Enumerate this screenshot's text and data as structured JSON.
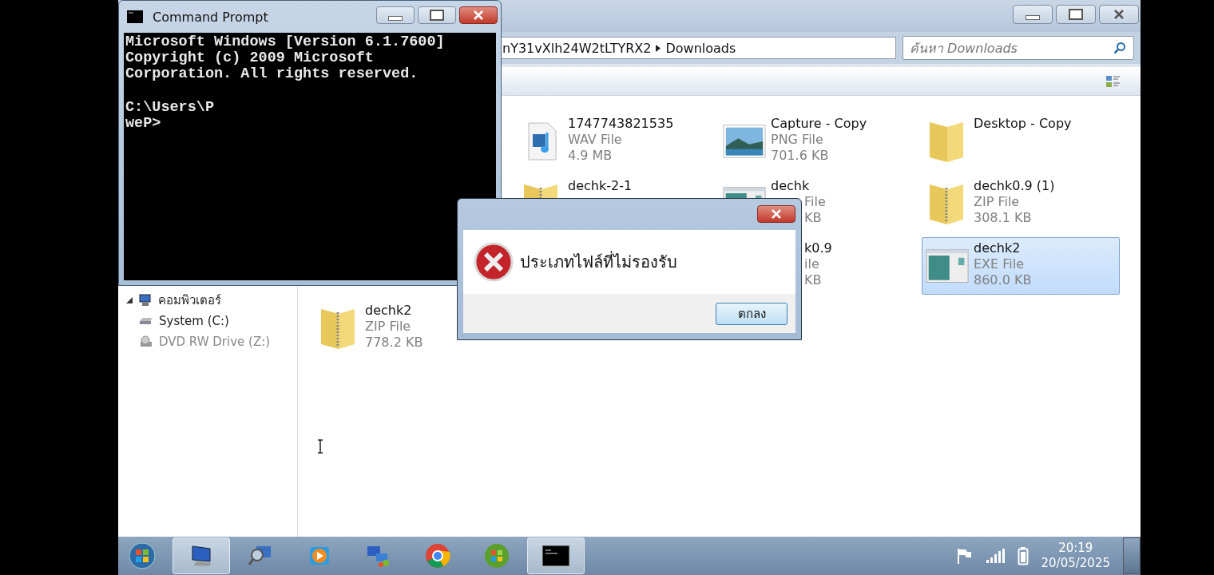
{
  "explorer": {
    "address": [
      "nY31vXlh24W2tLTYRX2",
      "Downloads"
    ],
    "search": {
      "placeholder": "ค้นหา Downloads"
    },
    "sidebar": [
      {
        "label": "คอมพิวเตอร์",
        "kind": "group",
        "expanded": true,
        "disabled": false
      },
      {
        "label": "System (C:)",
        "kind": "drive",
        "disabled": false
      },
      {
        "label": "DVD RW Drive (Z:)",
        "kind": "dvd",
        "disabled": true
      }
    ],
    "file_rows": [
      [
        {
          "kind": "wav",
          "name": "1747743821535",
          "details": [
            "WAV File",
            "4.9 MB"
          ],
          "selected": false
        },
        {
          "kind": "png",
          "name": "Capture - Copy",
          "details": [
            "PNG File",
            "701.6 KB"
          ],
          "selected": false
        },
        {
          "kind": "folder",
          "name": "Desktop - Copy",
          "selected": false
        }
      ],
      [
        {
          "kind": "zip",
          "name": "dechk-2-1",
          "selected": false
        },
        {
          "kind": "exe_covered",
          "name": "dechk",
          "details": [
            "File",
            "KB"
          ],
          "selected": false
        },
        {
          "kind": "zip",
          "name": "dechk0.9 (1)",
          "details": [
            "ZIP File",
            "308.1 KB"
          ],
          "selected": false
        }
      ],
      [
        {
          "kind": "fragment",
          "name": "k0.9",
          "details": [
            "ile",
            "KB"
          ],
          "selected": false
        },
        {
          "kind": "exe",
          "name": "dechk2",
          "details": [
            "EXE File",
            "860.0 KB"
          ],
          "selected": true
        }
      ],
      [
        {
          "kind": "zip",
          "name": "dechk2",
          "details": [
            "ZIP File",
            "778.2 KB"
          ],
          "selected": false
        }
      ]
    ]
  },
  "command_prompt": {
    "title": "Command Prompt",
    "paragraphs": [
      [
        "Microsoft Windows [Version 6.1.7600]",
        "Copyright (c) 2009 Microsoft",
        "Corporation. All rights reserved."
      ],
      [
        "C:\\Users\\P",
        "weP>"
      ]
    ]
  },
  "dialog": {
    "message": "ประเภทไฟล์ที่ไม่รองรับ",
    "button": "ตกลง"
  },
  "taskbar": {
    "apps": [
      {
        "kind": "explorer",
        "active": true
      },
      {
        "kind": "search",
        "active": false
      },
      {
        "kind": "media",
        "active": false
      },
      {
        "kind": "network",
        "active": false
      },
      {
        "kind": "chrome",
        "active": false
      },
      {
        "kind": "windows",
        "active": false
      },
      {
        "kind": "cmd",
        "active": true
      }
    ],
    "time": "20:19",
    "date": "20/05/2025"
  }
}
